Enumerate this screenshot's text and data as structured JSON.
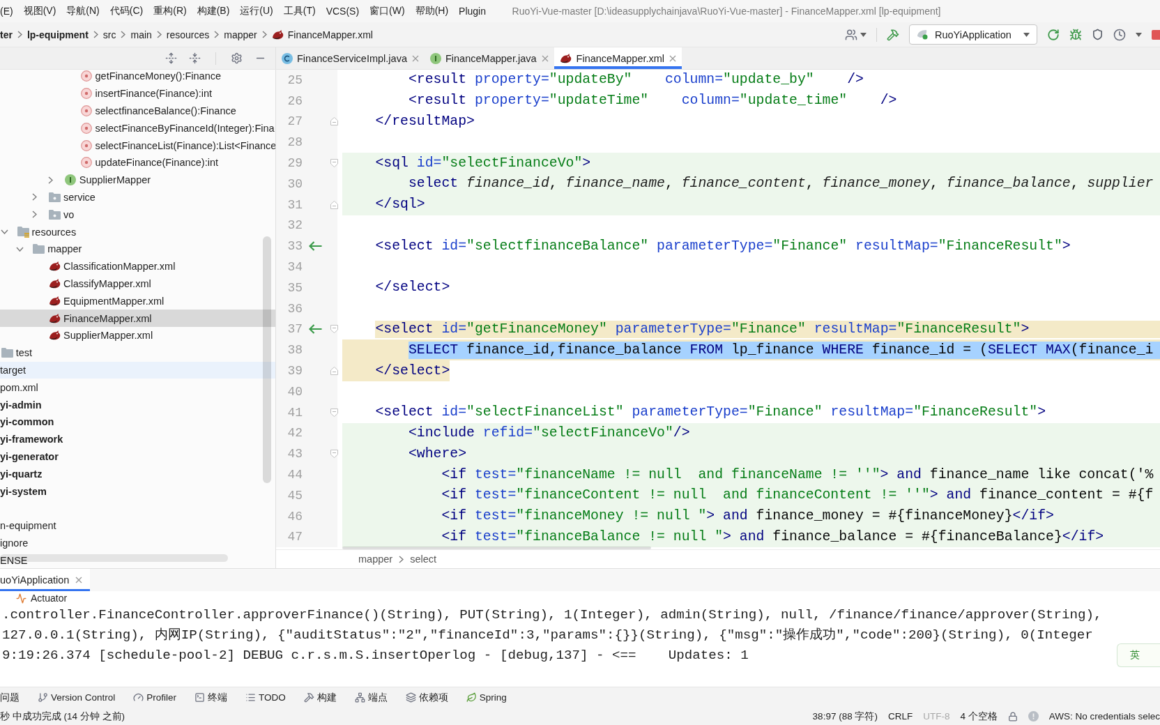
{
  "menu_bar": {
    "items": [
      "(E)",
      "视图(V)",
      "导航(N)",
      "代码(C)",
      "重构(R)",
      "构建(B)",
      "运行(U)",
      "工具(T)",
      "VCS(S)",
      "窗口(W)",
      "帮助(H)",
      "Plugin"
    ],
    "window_title": "RuoYi-Vue-master [D:\\ideasupplychainjava\\RuoYi-Vue-master] - FinanceMapper.xml [lp-equipment]"
  },
  "nav_bar": {
    "breadcrumbs": [
      {
        "label": "ter",
        "kind": "project"
      },
      {
        "label": "lp-equipment",
        "kind": "module"
      },
      {
        "label": "src",
        "kind": "folder"
      },
      {
        "label": "main",
        "kind": "folder"
      },
      {
        "label": "resources",
        "kind": "folder"
      },
      {
        "label": "mapper",
        "kind": "folder"
      },
      {
        "label": "FinanceMapper.xml",
        "kind": "mapper-xml"
      }
    ],
    "run_configuration": "RuoYiApplication"
  },
  "editor_tabs": [
    {
      "label": "FinanceServiceImpl.java",
      "kind": "class",
      "selected": false
    },
    {
      "label": "FinanceMapper.java",
      "kind": "interface",
      "selected": false
    },
    {
      "label": "FinanceMapper.xml",
      "kind": "mapper-xml",
      "selected": true
    }
  ],
  "project_tree": [
    {
      "children": [
        {
          "children": [
            {
              "children": [
                {
                  "children": [
                    {
                      "children": [
                        {
                          "children": [
                            {
                              "children": [
                                {
                                  "label": "getFinanceMoney():Finance",
                                  "kind": "method",
                                  "selected": false,
                                  "hovered": false
                                },
                                {
                                  "label": "insertFinance(Finance):int",
                                  "kind": "method",
                                  "selected": false,
                                  "hovered": false
                                },
                                {
                                  "label": "selectfinanceBalance():Finance",
                                  "kind": "method",
                                  "selected": false,
                                  "hovered": false
                                },
                                {
                                  "label": "selectFinanceByFinanceId(Integer):Fina",
                                  "kind": "method",
                                  "selected": false,
                                  "hovered": false
                                },
                                {
                                  "label": "selectFinanceList(Finance):List<Finance",
                                  "kind": "method",
                                  "selected": false,
                                  "hovered": false
                                },
                                {
                                  "label": "updateFinance(Finance):int",
                                  "kind": "method",
                                  "selected": false,
                                  "hovered": false
                                }
                              ]
                            },
                            {
                              "label": "SupplierMapper",
                              "kind": "interface",
                              "expanded": false,
                              "selected": false,
                              "hovered": false
                            }
                          ]
                        },
                        {
                          "label": "service",
                          "kind": "package",
                          "expanded": false,
                          "selected": false,
                          "hovered": false
                        },
                        {
                          "label": "vo",
                          "kind": "package",
                          "expanded": false,
                          "selected": false,
                          "hovered": false
                        }
                      ]
                    }
                  ]
                },
                {
                  "label": "resources",
                  "kind": "resources",
                  "expanded": true,
                  "selected": false,
                  "hovered": false,
                  "children": [
                    {
                      "label": "mapper",
                      "kind": "folder",
                      "expanded": true,
                      "selected": false,
                      "hovered": false,
                      "children": [
                        {
                          "label": "ClassificationMapper.xml",
                          "kind": "mapper-xml",
                          "selected": false,
                          "hovered": false
                        },
                        {
                          "label": "ClassifyMapper.xml",
                          "kind": "mapper-xml",
                          "selected": false,
                          "hovered": false
                        },
                        {
                          "label": "EquipmentMapper.xml",
                          "kind": "mapper-xml",
                          "selected": false,
                          "hovered": false
                        },
                        {
                          "label": "FinanceMapper.xml",
                          "kind": "mapper-xml",
                          "selected": true,
                          "hovered": false
                        },
                        {
                          "label": "SupplierMapper.xml",
                          "kind": "mapper-xml",
                          "selected": false,
                          "hovered": false
                        }
                      ]
                    }
                  ]
                }
              ]
            },
            {
              "label": "test",
              "kind": "folder",
              "selected": false,
              "hovered": false
            }
          ]
        },
        {
          "label": "target",
          "selected": false,
          "hovered": true
        },
        {
          "label": "pom.xml",
          "selected": false,
          "hovered": false
        }
      ]
    },
    {
      "label": "yi-admin",
      "kind": "module",
      "selected": false,
      "hovered": false
    },
    {
      "label": "yi-common",
      "kind": "module",
      "selected": false,
      "hovered": false
    },
    {
      "label": "yi-framework",
      "kind": "module",
      "selected": false,
      "hovered": false
    },
    {
      "label": "yi-generator",
      "kind": "module",
      "selected": false,
      "hovered": false
    },
    {
      "label": "yi-quartz",
      "kind": "module",
      "selected": false,
      "hovered": false
    },
    {
      "label": "yi-system",
      "kind": "module",
      "selected": false,
      "hovered": false
    }
  ],
  "project_files": [
    {
      "label": "n-equipment",
      "selected": false,
      "hovered": false
    },
    {
      "label": "ignore",
      "selected": false,
      "hovered": false
    },
    {
      "label": "ENSE",
      "selected": false,
      "hovered": false
    }
  ],
  "editor": {
    "lines": [
      {
        "number": "25",
        "kind": "plain",
        "selected": false,
        "tokens": [
          {
            "kind": "tag",
            "text": "        <result "
          },
          {
            "kind": "attr",
            "text": "property="
          },
          {
            "kind": "value",
            "text": "\"updateBy\"    "
          },
          {
            "kind": "attr",
            "text": "column="
          },
          {
            "kind": "value",
            "text": "\"update_by\"    "
          },
          {
            "kind": "tag",
            "text": "/>"
          }
        ]
      },
      {
        "number": "26",
        "kind": "plain",
        "selected": false,
        "tokens": [
          {
            "kind": "tag",
            "text": "        <result "
          },
          {
            "kind": "attr",
            "text": "property="
          },
          {
            "kind": "value",
            "text": "\"updateTime\"    "
          },
          {
            "kind": "attr",
            "text": "column="
          },
          {
            "kind": "value",
            "text": "\"update_time\"    "
          },
          {
            "kind": "tag",
            "text": "/>"
          }
        ]
      },
      {
        "number": "27",
        "kind": "plain",
        "selected": false,
        "fold_end": true,
        "tokens": [
          {
            "kind": "tag",
            "text": "    </resultMap>"
          }
        ]
      },
      {
        "number": "28",
        "kind": "plain"
      },
      {
        "number": "29",
        "kind": "sql",
        "selected": false,
        "fold_start": true,
        "tokens": [
          {
            "kind": "tag",
            "text": "    <sql "
          },
          {
            "kind": "attr",
            "text": "id="
          },
          {
            "kind": "value",
            "text": "\"selectFinanceVo\""
          },
          {
            "kind": "tag",
            "text": ">"
          }
        ]
      },
      {
        "number": "30",
        "kind": "sql",
        "selected": false,
        "tokens": [
          {
            "kind": "keyword",
            "text": "        select "
          },
          {
            "kind": "column",
            "text": "finance_id"
          },
          {
            "kind": "text",
            "text": ", "
          },
          {
            "kind": "column",
            "text": "finance_name"
          },
          {
            "kind": "text",
            "text": ", "
          },
          {
            "kind": "column",
            "text": "finance_content"
          },
          {
            "kind": "text",
            "text": ", "
          },
          {
            "kind": "column",
            "text": "finance_money"
          },
          {
            "kind": "text",
            "text": ", "
          },
          {
            "kind": "column",
            "text": "finance_balance"
          },
          {
            "kind": "text",
            "text": ", "
          },
          {
            "kind": "column",
            "text": "supplier"
          }
        ]
      },
      {
        "number": "31",
        "kind": "sql",
        "selected": false,
        "fold_end": true,
        "tokens": [
          {
            "kind": "tag",
            "text": "    </sql>"
          }
        ]
      },
      {
        "number": "32",
        "kind": "plain"
      },
      {
        "number": "33",
        "kind": "plain",
        "selected": false,
        "gutter_arrow": true,
        "tokens": [
          {
            "kind": "tag",
            "text": "    <select "
          },
          {
            "kind": "attr",
            "text": "id="
          },
          {
            "kind": "value",
            "text": "\"selectfinanceBalance\" "
          },
          {
            "kind": "attr",
            "text": "parameterType="
          },
          {
            "kind": "value",
            "text": "\"Finance\" "
          },
          {
            "kind": "attr",
            "text": "resultMap="
          },
          {
            "kind": "value",
            "text": "\"FinanceResult\""
          },
          {
            "kind": "tag",
            "text": ">"
          }
        ]
      },
      {
        "number": "34",
        "kind": "plain"
      },
      {
        "number": "35",
        "kind": "plain",
        "selected": false,
        "tokens": [
          {
            "kind": "tag",
            "text": "    </select>"
          }
        ]
      },
      {
        "number": "36",
        "kind": "plain"
      },
      {
        "number": "37",
        "kind": "tagmatch",
        "selected": false,
        "gutter_arrow": true,
        "fold_start": true,
        "tokens": [
          {
            "kind": "tag",
            "text": "    <select "
          },
          {
            "kind": "attr",
            "text": "id="
          },
          {
            "kind": "value",
            "text": "\"getFinanceMoney\" "
          },
          {
            "kind": "attr",
            "text": "parameterType="
          },
          {
            "kind": "value",
            "text": "\"Finance\" "
          },
          {
            "kind": "attr",
            "text": "resultMap="
          },
          {
            "kind": "value",
            "text": "\"FinanceResult\""
          },
          {
            "kind": "tag",
            "text": ">"
          }
        ]
      },
      {
        "number": "38",
        "kind": "caret",
        "selected": true,
        "tokens": [
          {
            "kind": "keyword",
            "text": "        SELECT "
          },
          {
            "kind": "text",
            "text": "finance_id,finance_balance "
          },
          {
            "kind": "keyword",
            "text": "FROM "
          },
          {
            "kind": "text",
            "text": "lp_finance "
          },
          {
            "kind": "keyword",
            "text": "WHERE "
          },
          {
            "kind": "text",
            "text": "finance_id = ("
          },
          {
            "kind": "keyword",
            "text": "SELECT MAX"
          },
          {
            "kind": "text",
            "text": "(finance_i"
          }
        ]
      },
      {
        "number": "39",
        "kind": "tagclose",
        "selected": false,
        "fold_end": true,
        "tokens": [
          {
            "kind": "tag",
            "text": "    </select>"
          }
        ]
      },
      {
        "number": "40",
        "kind": "plain"
      },
      {
        "number": "41",
        "kind": "plain",
        "selected": false,
        "fold_start": true,
        "tokens": [
          {
            "kind": "tag",
            "text": "    <select "
          },
          {
            "kind": "attr",
            "text": "id="
          },
          {
            "kind": "value",
            "text": "\"selectFinanceList\" "
          },
          {
            "kind": "attr",
            "text": "parameterType="
          },
          {
            "kind": "value",
            "text": "\"Finance\" "
          },
          {
            "kind": "attr",
            "text": "resultMap="
          },
          {
            "kind": "value",
            "text": "\"FinanceResult\""
          },
          {
            "kind": "tag",
            "text": ">"
          }
        ]
      },
      {
        "number": "42",
        "kind": "sql",
        "selected": false,
        "tokens": [
          {
            "kind": "tag",
            "text": "        <include "
          },
          {
            "kind": "attr",
            "text": "refid="
          },
          {
            "kind": "value",
            "text": "\"selectFinanceVo\""
          },
          {
            "kind": "tag",
            "text": "/>"
          }
        ]
      },
      {
        "number": "43",
        "kind": "sql",
        "selected": false,
        "fold_start": true,
        "tokens": [
          {
            "kind": "tag",
            "text": "        <where>"
          }
        ]
      },
      {
        "number": "44",
        "kind": "sql",
        "selected": false,
        "tokens": [
          {
            "kind": "tag",
            "text": "            <if "
          },
          {
            "kind": "attr",
            "text": "test="
          },
          {
            "kind": "value",
            "text": "\"financeName != null  and financeName != ''\""
          },
          {
            "kind": "tag",
            "text": "> "
          },
          {
            "kind": "keyword",
            "text": "and "
          },
          {
            "kind": "text",
            "text": "finance_name like concat('%"
          }
        ]
      },
      {
        "number": "45",
        "kind": "sql",
        "selected": false,
        "tokens": [
          {
            "kind": "tag",
            "text": "            <if "
          },
          {
            "kind": "attr",
            "text": "test="
          },
          {
            "kind": "value",
            "text": "\"financeContent != null  and financeContent != ''\""
          },
          {
            "kind": "tag",
            "text": "> "
          },
          {
            "kind": "keyword",
            "text": "and "
          },
          {
            "kind": "text",
            "text": "finance_content = #{f"
          }
        ]
      },
      {
        "number": "46",
        "kind": "sql",
        "selected": false,
        "tokens": [
          {
            "kind": "tag",
            "text": "            <if "
          },
          {
            "kind": "attr",
            "text": "test="
          },
          {
            "kind": "value",
            "text": "\"financeMoney != null \""
          },
          {
            "kind": "tag",
            "text": "> "
          },
          {
            "kind": "keyword",
            "text": "and "
          },
          {
            "kind": "text",
            "text": "finance_money = #{financeMoney}"
          },
          {
            "kind": "tag",
            "text": "</if>"
          }
        ]
      },
      {
        "number": "47",
        "kind": "sql",
        "selected": false,
        "tokens": [
          {
            "kind": "tag",
            "text": "            <if "
          },
          {
            "kind": "attr",
            "text": "test="
          },
          {
            "kind": "value",
            "text": "\"financeBalance != null \""
          },
          {
            "kind": "tag",
            "text": "> "
          },
          {
            "kind": "keyword",
            "text": "and "
          },
          {
            "kind": "text",
            "text": "finance_balance = #{financeBalance}"
          },
          {
            "kind": "tag",
            "text": "</if>"
          }
        ]
      }
    ],
    "breadcrumbs": [
      "mapper",
      "select"
    ]
  },
  "run_panel": {
    "tabs": [
      {
        "label": "uoYiApplication",
        "selected": true
      }
    ],
    "toolbar_button": "Actuator",
    "console": [
      ".controller.FinanceController.approverFinance()(String), PUT(String), 1(Integer), admin(String), null, /finance/finance/approver(String),",
      "127.0.0.1(String), 内网IP(String), {\"auditStatus\":\"2\",\"financeId\":3,\"params\":{}}(String), {\"msg\":\"操作成功\",\"code\":200}(String), 0(Integer",
      "9:19:26.374 [schedule-pool-2] DEBUG c.r.s.m.S.insertOperlog - [debug,137] - <==    Updates: 1"
    ],
    "input_method": "英"
  },
  "tool_stripe": [
    {
      "label": "问题",
      "kind": "problems"
    },
    {
      "label": "Version Control",
      "kind": "vcs"
    },
    {
      "label": "Profiler",
      "kind": "profiler"
    },
    {
      "label": "终端",
      "kind": "terminal"
    },
    {
      "label": "TODO",
      "kind": "todo"
    },
    {
      "label": "构建",
      "kind": "build"
    },
    {
      "label": "端点",
      "kind": "endpoints"
    },
    {
      "label": "依赖项",
      "kind": "dependencies"
    },
    {
      "label": "Spring",
      "kind": "spring"
    }
  ],
  "status_bar": {
    "message": "秒 中成功完成 (14 分钟 之前)",
    "items": [
      {
        "label": "38:97 (88 字符)",
        "disabled": false
      },
      {
        "label": "CRLF",
        "disabled": false
      },
      {
        "label": "UTF-8",
        "disabled": true
      },
      {
        "label": "4 个空格",
        "disabled": false
      }
    ],
    "aws": "AWS: No credentials selec"
  }
}
